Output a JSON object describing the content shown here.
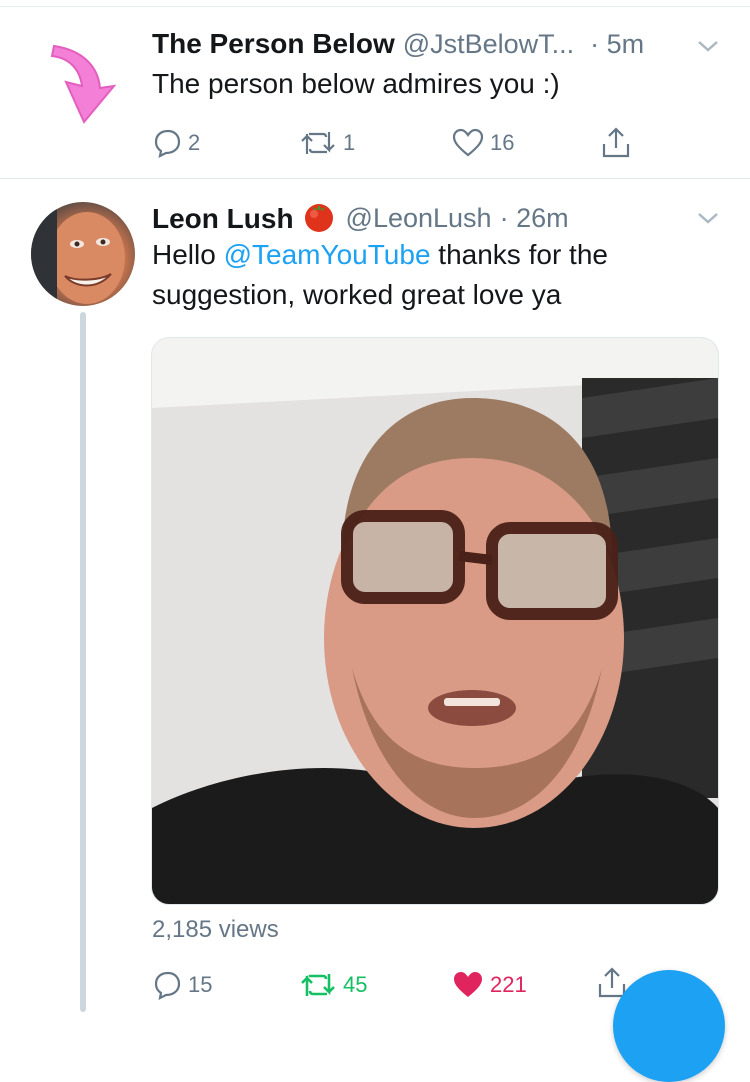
{
  "tweet1": {
    "name": "The Person Below",
    "handle": "@JstBelowT...",
    "time": "· 5m",
    "text": "The person below admires you :)",
    "replies": "2",
    "retweets": "1",
    "likes": "16"
  },
  "tweet2": {
    "name": "Leon Lush",
    "handle": "@LeonLush",
    "time": "· 26m",
    "text_before": "Hello ",
    "mention": "@TeamYouTube",
    "text_after": " thanks for the suggestion, worked great love ya",
    "views": "2,185 views",
    "replies": "15",
    "retweets": "45",
    "likes": "221"
  },
  "colors": {
    "accent": "#1da1f2",
    "retweet_active": "#17bf63",
    "like_active": "#e0245e",
    "muted": "#657786",
    "arrow_pink": "#f47fd6"
  }
}
